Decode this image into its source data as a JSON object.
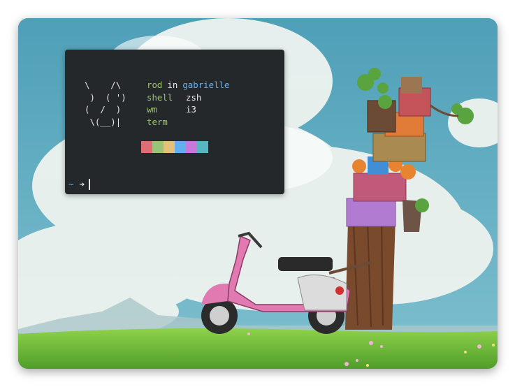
{
  "terminal": {
    "ascii_art": "\\    /\\\n )  ( ')\n(  /  )\n \\(__)|",
    "user": "rod",
    "in_word": "in",
    "host": "gabrielle",
    "rows": [
      {
        "key": "shell",
        "value": "zsh"
      },
      {
        "key": "wm",
        "value": "i3"
      },
      {
        "key": "term",
        "value": ""
      }
    ],
    "prompt_dir": "~",
    "prompt_arrow": "➜",
    "swatch_colors": [
      "#e06c75",
      "#98c379",
      "#e5c07b",
      "#61afef",
      "#c678dd",
      "#56b6c2"
    ]
  },
  "colors": {
    "terminal_bg": "#24282b",
    "key_green": "#9cc36c",
    "host_blue": "#6fb0e8",
    "sky": "#58a7bf",
    "grass": "#6fbf3a",
    "scooter_pink": "#e07ab0"
  }
}
